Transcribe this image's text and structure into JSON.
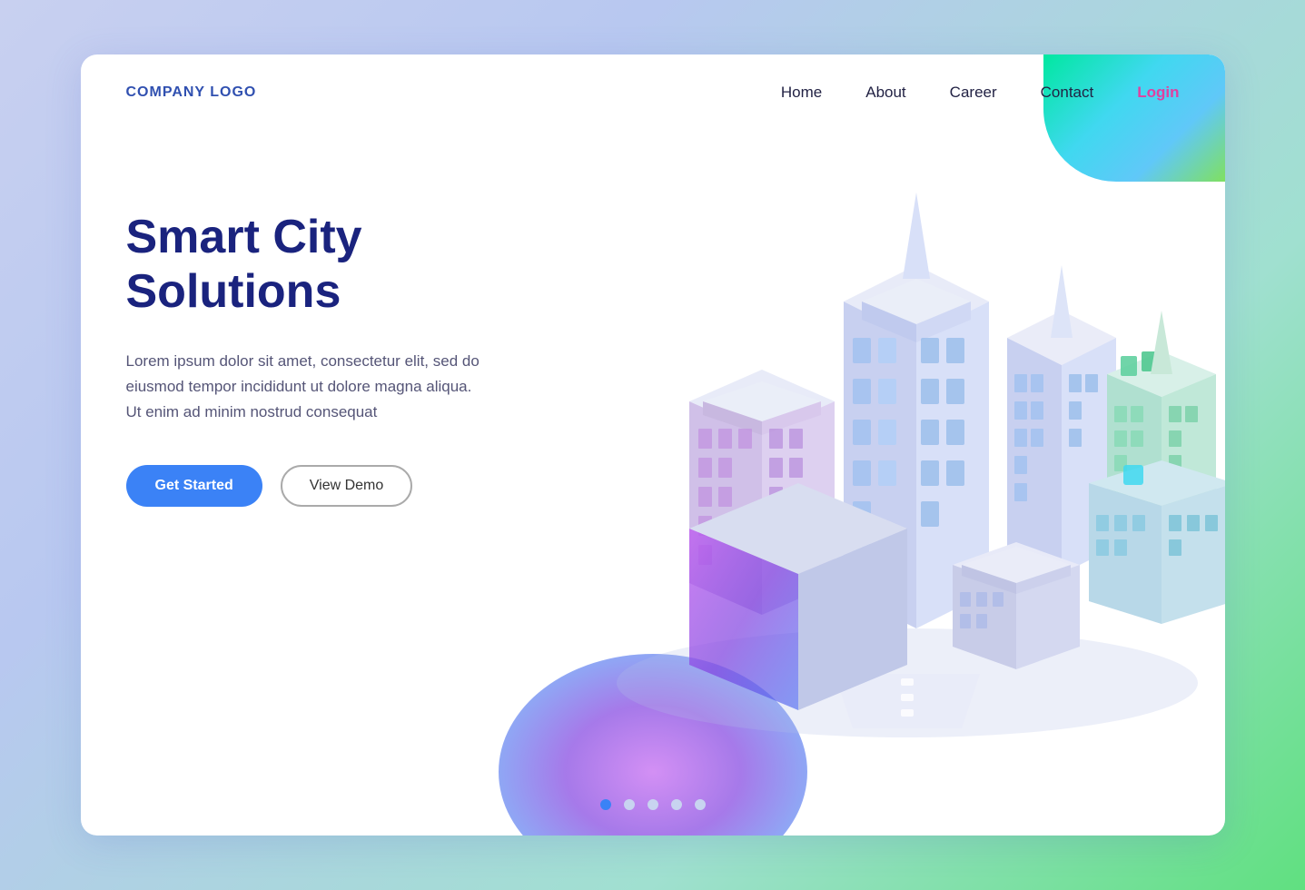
{
  "navbar": {
    "logo": "COMPANY LOGO",
    "links": [
      {
        "label": "Home",
        "active": false
      },
      {
        "label": "About",
        "active": false
      },
      {
        "label": "Career",
        "active": false
      },
      {
        "label": "Contact",
        "active": false
      },
      {
        "label": "Login",
        "login": true
      }
    ]
  },
  "hero": {
    "title": "Smart City Solutions",
    "description": "Lorem ipsum dolor sit amet, consectetur elit, sed do eiusmod tempor incididunt ut dolore magna aliqua. Ut enim ad minim nostrud consequat",
    "btn_primary": "Get Started",
    "btn_secondary": "View Demo"
  },
  "dots": {
    "count": 5,
    "active_index": 0
  },
  "colors": {
    "accent_blue": "#3b82f6",
    "accent_pink": "#e040a0",
    "logo_color": "#3050b0",
    "title_color": "#1a237e"
  }
}
